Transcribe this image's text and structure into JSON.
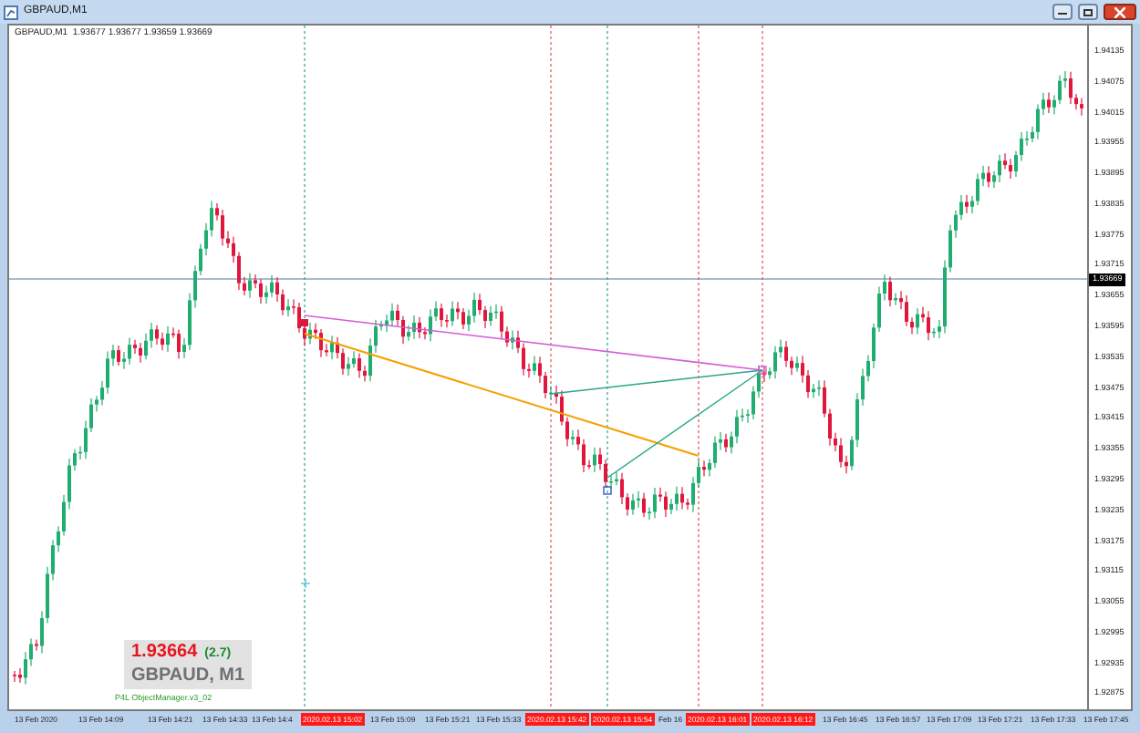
{
  "window": {
    "title": "GBPAUD,M1",
    "controls": [
      {
        "kind": "minimize"
      },
      {
        "kind": "maximize"
      },
      {
        "kind": "close"
      }
    ]
  },
  "chart": {
    "info": "GBPAUD,M1  1.93677 1.93677 1.93659 1.93669",
    "price_labels": [
      "1.94135",
      "1.94075",
      "1.94015",
      "1.93955",
      "1.93895",
      "1.93835",
      "1.93775",
      "1.93715",
      "1.93655",
      "1.93595",
      "1.93535",
      "1.93475",
      "1.93415",
      "1.93355",
      "1.93295",
      "1.93235",
      "1.93175",
      "1.93115",
      "1.93055",
      "1.92995",
      "1.92935",
      "1.92875"
    ],
    "current_price": "1.93669",
    "time_labels": [
      {
        "text": "13 Feb 2020",
        "highlighted": false
      },
      {
        "text": "13 Feb 14:09",
        "highlighted": false
      },
      {
        "text": "13 Feb 14:21",
        "highlighted": false
      },
      {
        "text": "13 Feb 14:33",
        "highlighted": false
      },
      {
        "text": "13 Feb 14:4",
        "highlighted": false
      },
      {
        "text": "2020.02.13 15:02",
        "highlighted": true
      },
      {
        "text": "13 Feb 15:09",
        "highlighted": false
      },
      {
        "text": "13 Feb 15:21",
        "highlighted": false
      },
      {
        "text": "13 Feb 15:33",
        "highlighted": false
      },
      {
        "text": "2020.02.13 15:42",
        "highlighted": true
      },
      {
        "text": "2020.02.13 15:54",
        "highlighted": true
      },
      {
        "text": "Feb 16",
        "highlighted": false
      },
      {
        "text": "2020.02.13 16:01",
        "highlighted": true
      },
      {
        "text": "2020.02.13 16:12",
        "highlighted": true
      },
      {
        "text": "13 Feb 16:45",
        "highlighted": false
      },
      {
        "text": "13 Feb 16:57",
        "highlighted": false
      },
      {
        "text": "13 Feb 17:09",
        "highlighted": false
      },
      {
        "text": "13 Feb 17:21",
        "highlighted": false
      },
      {
        "text": "13 Feb 17:33",
        "highlighted": false
      },
      {
        "text": "13 Feb 17:45",
        "highlighted": false
      }
    ],
    "overlay": {
      "price": "1.93664",
      "change": "(2.7)",
      "symbol": "GBPAUD, M1",
      "caption": "P4L ObjectManager.v3_02"
    }
  }
}
